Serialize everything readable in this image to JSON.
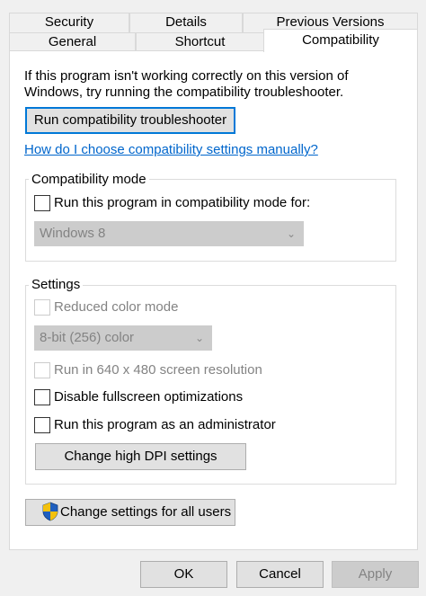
{
  "tabs_back": [
    "Security",
    "Details",
    "Previous Versions"
  ],
  "tabs_front": [
    "General",
    "Shortcut",
    "Compatibility"
  ],
  "intro_text": "If this program isn't working correctly on this version of Windows, try running the compatibility troubleshooter.",
  "troubleshooter_button": "Run compatibility troubleshooter",
  "help_link": "How do I choose compatibility settings manually?",
  "compat_mode": {
    "title": "Compatibility mode",
    "checkbox_label": "Run this program in compatibility mode for:",
    "checked": false,
    "os_select": "Windows 8"
  },
  "settings": {
    "title": "Settings",
    "reduced_color_label": "Reduced color mode",
    "color_select": "8-bit (256) color",
    "resolution_label": "Run in 640 x 480 screen resolution",
    "fullscreen_label": "Disable fullscreen optimizations",
    "admin_label": "Run this program as an administrator",
    "dpi_button": "Change high DPI settings"
  },
  "all_users_button": "Change settings for all users",
  "footer": {
    "ok": "OK",
    "cancel": "Cancel",
    "apply": "Apply"
  },
  "colors": {
    "link": "#0066cc",
    "focus_border": "#0078d7",
    "shield_blue": "#1f5fbf",
    "shield_yellow": "#f3c10e"
  }
}
